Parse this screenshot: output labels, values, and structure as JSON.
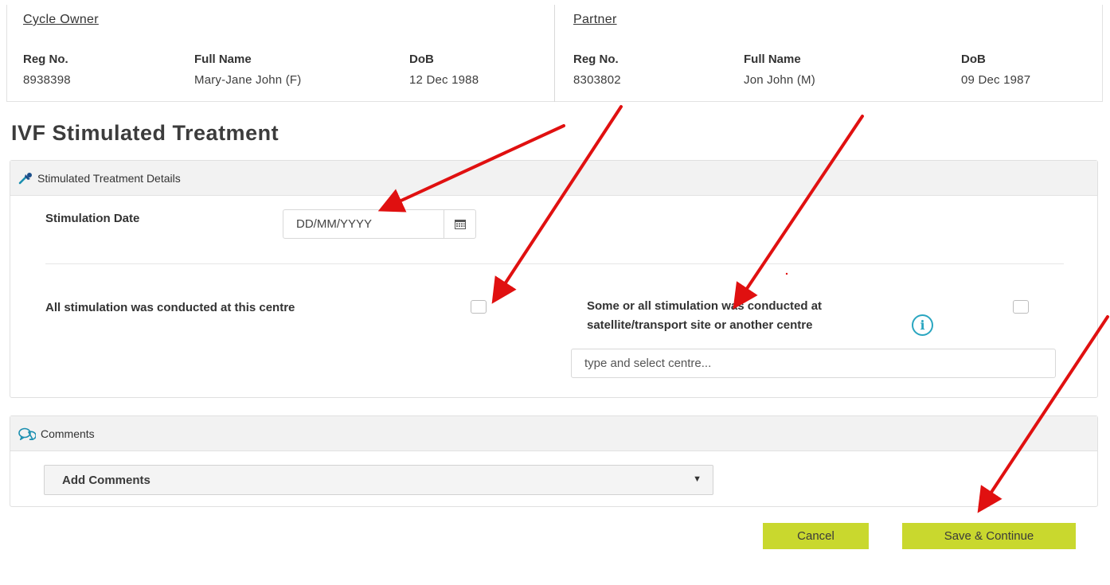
{
  "cycle_owner": {
    "heading": "Cycle Owner",
    "reg_label": "Reg No.",
    "name_label": "Full Name",
    "dob_label": "DoB",
    "reg": "8938398",
    "name": "Mary-Jane John (F)",
    "dob": "12 Dec 1988"
  },
  "partner": {
    "heading": "Partner",
    "reg_label": "Reg No.",
    "name_label": "Full Name",
    "dob_label": "DoB",
    "reg": "8303802",
    "name": "Jon John (M)",
    "dob": "09 Dec 1987"
  },
  "page_title": "IVF Stimulated Treatment",
  "details": {
    "header": "Stimulated Treatment Details",
    "date_label": "Stimulation Date",
    "date_placeholder": "DD/MM/YYYY",
    "all_here_label": "All stimulation was conducted at this centre",
    "other_site_line1": "Some or all stimulation was conducted at",
    "other_site_line2": "satellite/transport site or another centre",
    "centre_placeholder": "type and select centre...",
    "info_glyph": "i"
  },
  "comments": {
    "header": "Comments",
    "select_value": "Add Comments"
  },
  "actions": {
    "cancel": "Cancel",
    "save": "Save & Continue"
  },
  "colors": {
    "button": "#c9d82e",
    "info": "#2aa6c0",
    "annotation_arrow": "#e01010"
  }
}
